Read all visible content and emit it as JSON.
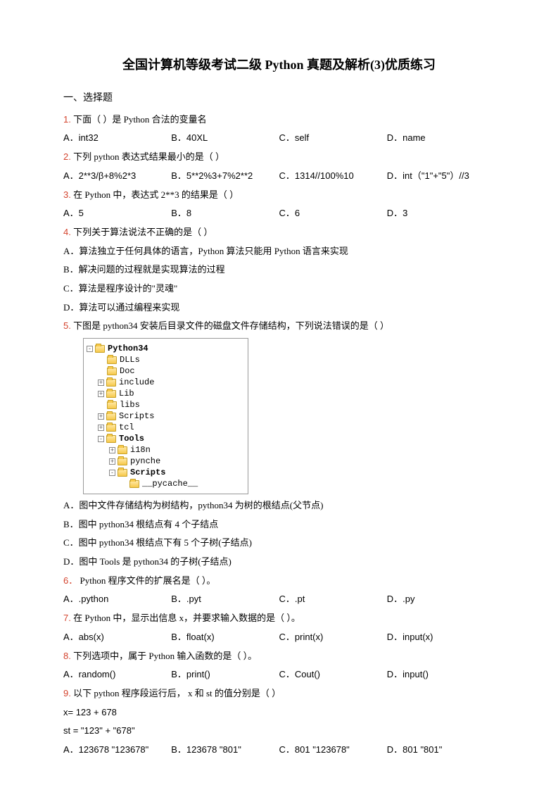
{
  "title": "全国计算机等级考试二级 Python 真题及解析(3)优质练习",
  "section1": "一、选择题",
  "q1": {
    "num": "1.",
    "text": "下面（  ）是 Python 合法的变量名",
    "opts": [
      "A．int32",
      "B．40XL",
      "C．self",
      "D．name"
    ]
  },
  "q2": {
    "num": "2.",
    "text": "下列 python 表达式结果最小的是（   ）",
    "opts": [
      "A．2**3/β+8%2*3",
      "B．5**2%3+7%2**2",
      "C．1314//100%10",
      "D．int（\"1\"+\"5\"）//3"
    ]
  },
  "q3": {
    "num": "3.",
    "text": "在 Python 中，表达式 2**3 的结果是（ ）",
    "opts": [
      "A．5",
      "B．8",
      "C．6",
      "D．3"
    ]
  },
  "q4": {
    "num": "4.",
    "text": "下列关于算法说法不正确的是（  ）",
    "A": "A．算法独立于任何具体的语言，Python 算法只能用 Python 语言来实现",
    "B": "B．解决问题的过程就是实现算法的过程",
    "C": "C．算法是程序设计的\"灵魂\"",
    "D": "D．算法可以通过编程来实现"
  },
  "q5": {
    "num": "5.",
    "text": "下图是 python34 安装后目录文件的磁盘文件存储结构，下列说法错误的是（  ）",
    "A": "A．图中文件存储结构为树结构，python34 为树的根结点(父节点)",
    "B": "B．图中 python34 根结点有 4 个子结点",
    "C": "C．图中 python34 根结点下有 5 个子树(子结点)",
    "D": "D．图中 Tools 是 python34 的子树(子结点)"
  },
  "tree": {
    "Python34": "Python34",
    "DLLs": "DLLs",
    "Doc": "Doc",
    "include": "include",
    "Lib": "Lib",
    "libs": "libs",
    "Scripts": "Scripts",
    "tcl": "tcl",
    "Tools": "Tools",
    "i18n": "i18n",
    "pynche": "pynche",
    "Scripts2": "Scripts",
    "pycache": "__pycache__"
  },
  "q6": {
    "num": "6．",
    "text": "Python 程序文件的扩展名是（   ）。",
    "opts": [
      "A．.python",
      "B．.pyt",
      "C．.pt",
      "D．.py"
    ]
  },
  "q7": {
    "num": "7.",
    "text": "在 Python 中，显示出信息 x，并要求输入数据的是（  ）。",
    "opts": [
      "A．abs(x)",
      "B．float(x)",
      "C．print(x)",
      "D．input(x)"
    ]
  },
  "q8": {
    "num": "8.",
    "text": "下列选项中，属于 Python 输入函数的是（  ）。",
    "opts": [
      "A．random()",
      "B．print()",
      "C．Cout()",
      "D．input()"
    ]
  },
  "q9": {
    "num": "9.",
    "text": "以下 python 程序段运行后， x 和 st 的值分别是（  ）",
    "code1": "x= 123 + 678",
    "code2": "st = \"123\" + \"678\"",
    "opts": [
      "A．123678 \"123678\"",
      "B．123678 \"801\"",
      "C．801 \"123678\"",
      "D．801 \"801\""
    ]
  }
}
